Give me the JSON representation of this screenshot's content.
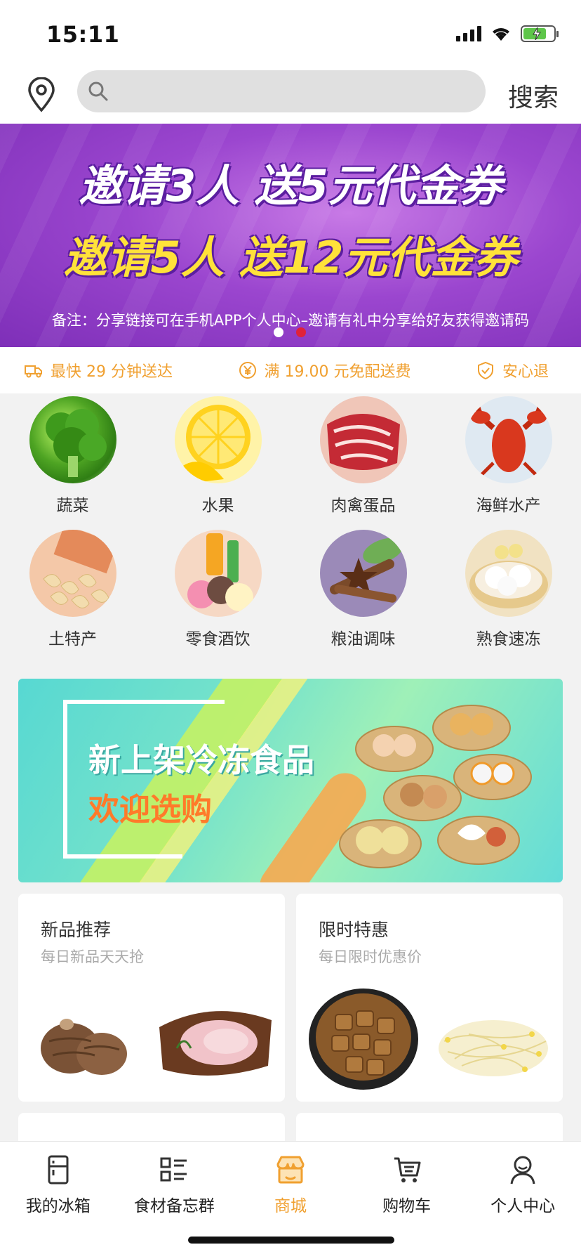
{
  "status_bar": {
    "time": "15:11",
    "signal_icon": "signal-icon",
    "wifi_icon": "wifi-icon",
    "battery_icon": "battery-charging-icon"
  },
  "search": {
    "placeholder": "",
    "button_label": "搜索",
    "location_icon": "location-pin-icon",
    "search_icon": "search-icon"
  },
  "banner": {
    "line1": "邀请3人 送5元代金券",
    "line2": "邀请5人 送12元代金券",
    "note": "备注：分享链接可在手机APP个人中心–邀请有礼中分享给好友获得邀请码",
    "slides": 2,
    "active_slide": 2
  },
  "services": [
    {
      "icon": "delivery-truck-icon",
      "label": "最快 29 分钟送达"
    },
    {
      "icon": "yen-circle-icon",
      "label": "满 19.00 元免配送费"
    },
    {
      "icon": "shield-check-icon",
      "label": "安心退"
    }
  ],
  "categories": [
    {
      "label": "蔬菜"
    },
    {
      "label": "水果"
    },
    {
      "label": "肉禽蛋品"
    },
    {
      "label": "海鲜水产"
    },
    {
      "label": "土特产"
    },
    {
      "label": "零食酒饮"
    },
    {
      "label": "粮油调味"
    },
    {
      "label": "熟食速冻"
    }
  ],
  "promo": {
    "title": "新上架冷冻食品",
    "subtitle": "欢迎选购"
  },
  "cards": [
    {
      "title": "新品推荐",
      "subtitle": "每日新品天天抢"
    },
    {
      "title": "限时特惠",
      "subtitle": "每日限时优惠价"
    }
  ],
  "tabs": [
    {
      "label": "我的冰箱",
      "icon": "fridge-icon"
    },
    {
      "label": "食材备忘群",
      "icon": "list-icon"
    },
    {
      "label": "商城",
      "icon": "store-icon",
      "active": true
    },
    {
      "label": "购物车",
      "icon": "cart-icon"
    },
    {
      "label": "个人中心",
      "icon": "user-icon"
    }
  ],
  "colors": {
    "accent": "#f0a030",
    "banner_purple": "#9b46cf",
    "banner_yellow": "#ffe23a",
    "dot_active": "#e0223a"
  }
}
